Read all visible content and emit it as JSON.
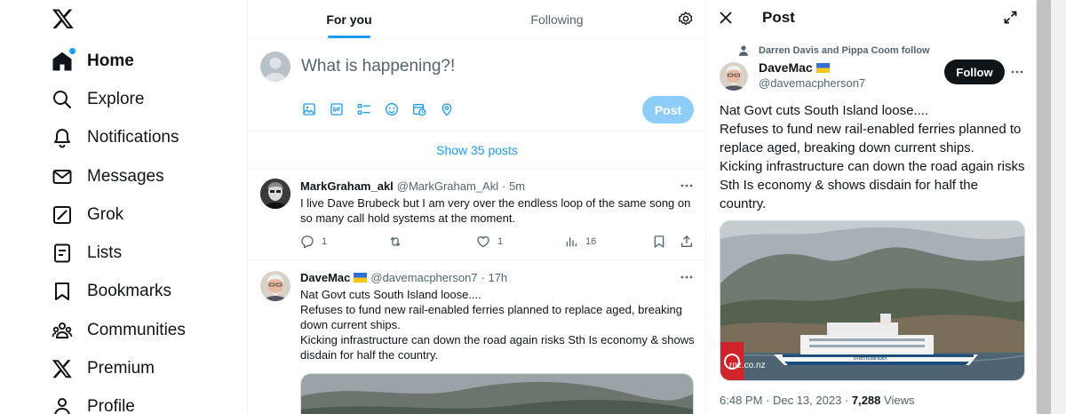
{
  "nav": {
    "logo_icon": "x-logo-icon",
    "items": [
      {
        "label": "Home",
        "icon": "home-icon",
        "active": true
      },
      {
        "label": "Explore",
        "icon": "search-icon"
      },
      {
        "label": "Notifications",
        "icon": "bell-icon"
      },
      {
        "label": "Messages",
        "icon": "envelope-icon"
      },
      {
        "label": "Grok",
        "icon": "grok-icon"
      },
      {
        "label": "Lists",
        "icon": "list-icon"
      },
      {
        "label": "Bookmarks",
        "icon": "bookmark-icon"
      },
      {
        "label": "Communities",
        "icon": "people-icon"
      },
      {
        "label": "Premium",
        "icon": "x-logo-icon"
      },
      {
        "label": "Profile",
        "icon": "person-icon"
      }
    ]
  },
  "timeline": {
    "tabs": [
      {
        "label": "For you",
        "active": true
      },
      {
        "label": "Following"
      }
    ],
    "composer": {
      "placeholder": "What is happening?!",
      "post_label": "Post",
      "tools": [
        "image-icon",
        "gif-icon",
        "poll-icon",
        "emoji-icon",
        "schedule-icon",
        "location-icon"
      ]
    },
    "show_posts": "Show 35 posts",
    "tweets": [
      {
        "name": "MarkGraham_akl",
        "handle": "@MarkGraham_Akl",
        "time": "· 5m",
        "text": "I live Dave Brubeck but I am very over the endless loop of the same song on so many call hold systems at the moment.",
        "replies": "1",
        "reposts": "",
        "likes": "1",
        "views": "16"
      },
      {
        "name": "DaveMac",
        "handle": "@davemacpherson7",
        "time": "· 17h",
        "text_lines": [
          "Nat Govt cuts South Island loose....",
          "Refuses to fund new rail-enabled ferries planned to replace aged, breaking down current ships.",
          "Kicking infrastructure can down the road again risks Sth Is economy & shows disdain for half the country."
        ]
      }
    ]
  },
  "detail": {
    "title": "Post",
    "social_context": "Darren Davis and Pippa Coom follow",
    "name": "DaveMac",
    "handle": "@davemacpherson7",
    "follow_label": "Follow",
    "text_lines": [
      "Nat Govt cuts South Island loose....",
      "Refuses to fund new rail-enabled ferries planned to replace aged, breaking down current ships.",
      "Kicking infrastructure can down the road again risks Sth Is economy & shows disdain for half the country."
    ],
    "image_watermark": "rnz.co.nz",
    "ship_name": "interislander",
    "timestamp": "6:48 PM · Dec 13, 2023 · ",
    "views_count": "7,288",
    "views_label": " Views"
  },
  "colors": {
    "accent": "#1d9bf0",
    "text": "#0f1419",
    "muted": "#536471",
    "border": "#eff3f4"
  }
}
